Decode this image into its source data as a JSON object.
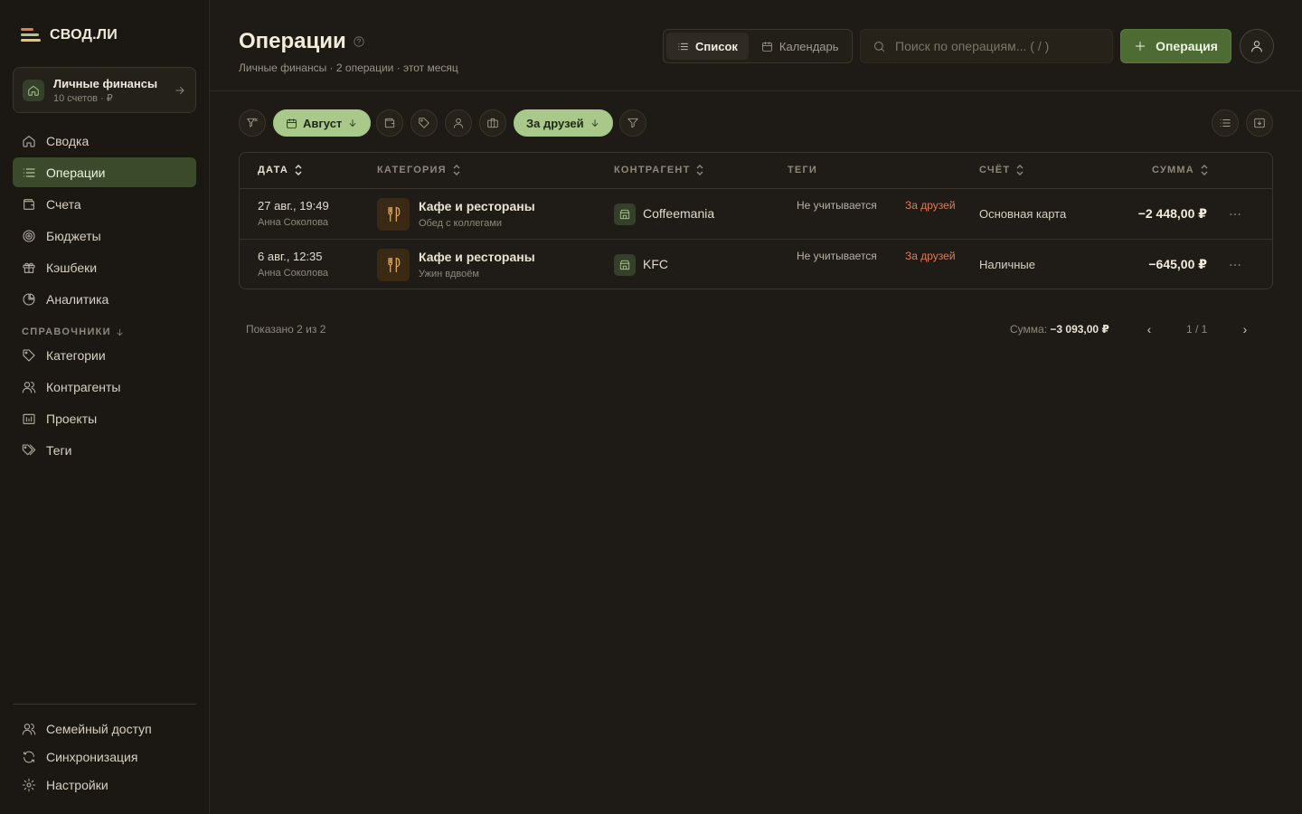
{
  "app": {
    "logo_text": "СВОД.ЛИ"
  },
  "workspace": {
    "title": "Личные финансы",
    "subtitle": "10 счетов · ₽"
  },
  "nav": {
    "items": [
      {
        "label": "Сводка",
        "icon": "home-icon"
      },
      {
        "label": "Операции",
        "icon": "list-icon"
      },
      {
        "label": "Счета",
        "icon": "wallet-icon"
      },
      {
        "label": "Бюджеты",
        "icon": "target-icon"
      },
      {
        "label": "Кэшбеки",
        "icon": "gift-icon"
      },
      {
        "label": "Аналитика",
        "icon": "pie-chart-icon"
      }
    ],
    "section_label": "СПРАВОЧНИКИ",
    "refs": [
      {
        "label": "Категории",
        "icon": "tag-icon"
      },
      {
        "label": "Контрагенты",
        "icon": "users-icon"
      },
      {
        "label": "Проекты",
        "icon": "folder-icon"
      },
      {
        "label": "Теги",
        "icon": "tags-icon"
      }
    ],
    "bottom": [
      {
        "label": "Семейный доступ",
        "icon": "family-icon"
      },
      {
        "label": "Синхронизация",
        "icon": "sync-icon"
      },
      {
        "label": "Настройки",
        "icon": "gear-icon"
      }
    ]
  },
  "header": {
    "title": "Операции",
    "subtitle": "Личные финансы · 2 операции · этот месяц",
    "view_list": "Список",
    "view_calendar": "Календарь",
    "search_placeholder": "Поиск по операциям... ( / )",
    "add_label": "Операция"
  },
  "filters": {
    "month": "Август",
    "for_friends": "За друзей"
  },
  "table": {
    "columns": [
      "ДАТА",
      "КАТЕГОРИЯ",
      "КОНТРАГЕНТ",
      "ТЕГИ",
      "СЧЁТ",
      "СУММА"
    ],
    "rows": [
      {
        "date": "27 авг., 19:49",
        "person": "Анна Соколова",
        "category": "Кафе и рестораны",
        "note": "Обед с коллегами",
        "counterparty": "Coffeemania",
        "tag1": "Не учитывается",
        "tag2": "За друзей",
        "account": "Основная карта",
        "amount": "−2 448,00 ₽"
      },
      {
        "date": "6 авг., 12:35",
        "person": "Анна Соколова",
        "category": "Кафе и рестораны",
        "note": "Ужин вдвоём",
        "counterparty": "KFC",
        "tag1": "Не учитывается",
        "tag2": "За друзей",
        "account": "Наличные",
        "amount": "−645,00 ₽"
      }
    ]
  },
  "footer": {
    "shown": "Показано 2 из 2",
    "sum_label": "Сумма:",
    "sum_value": "−3 093,00 ₽",
    "page": "1 / 1",
    "prev": "‹",
    "next": "›"
  },
  "colors": {
    "background": "#1e1b16",
    "accent": "#4d6b33",
    "accent_light": "#a9c98a",
    "tag_red": "#e27a55"
  }
}
